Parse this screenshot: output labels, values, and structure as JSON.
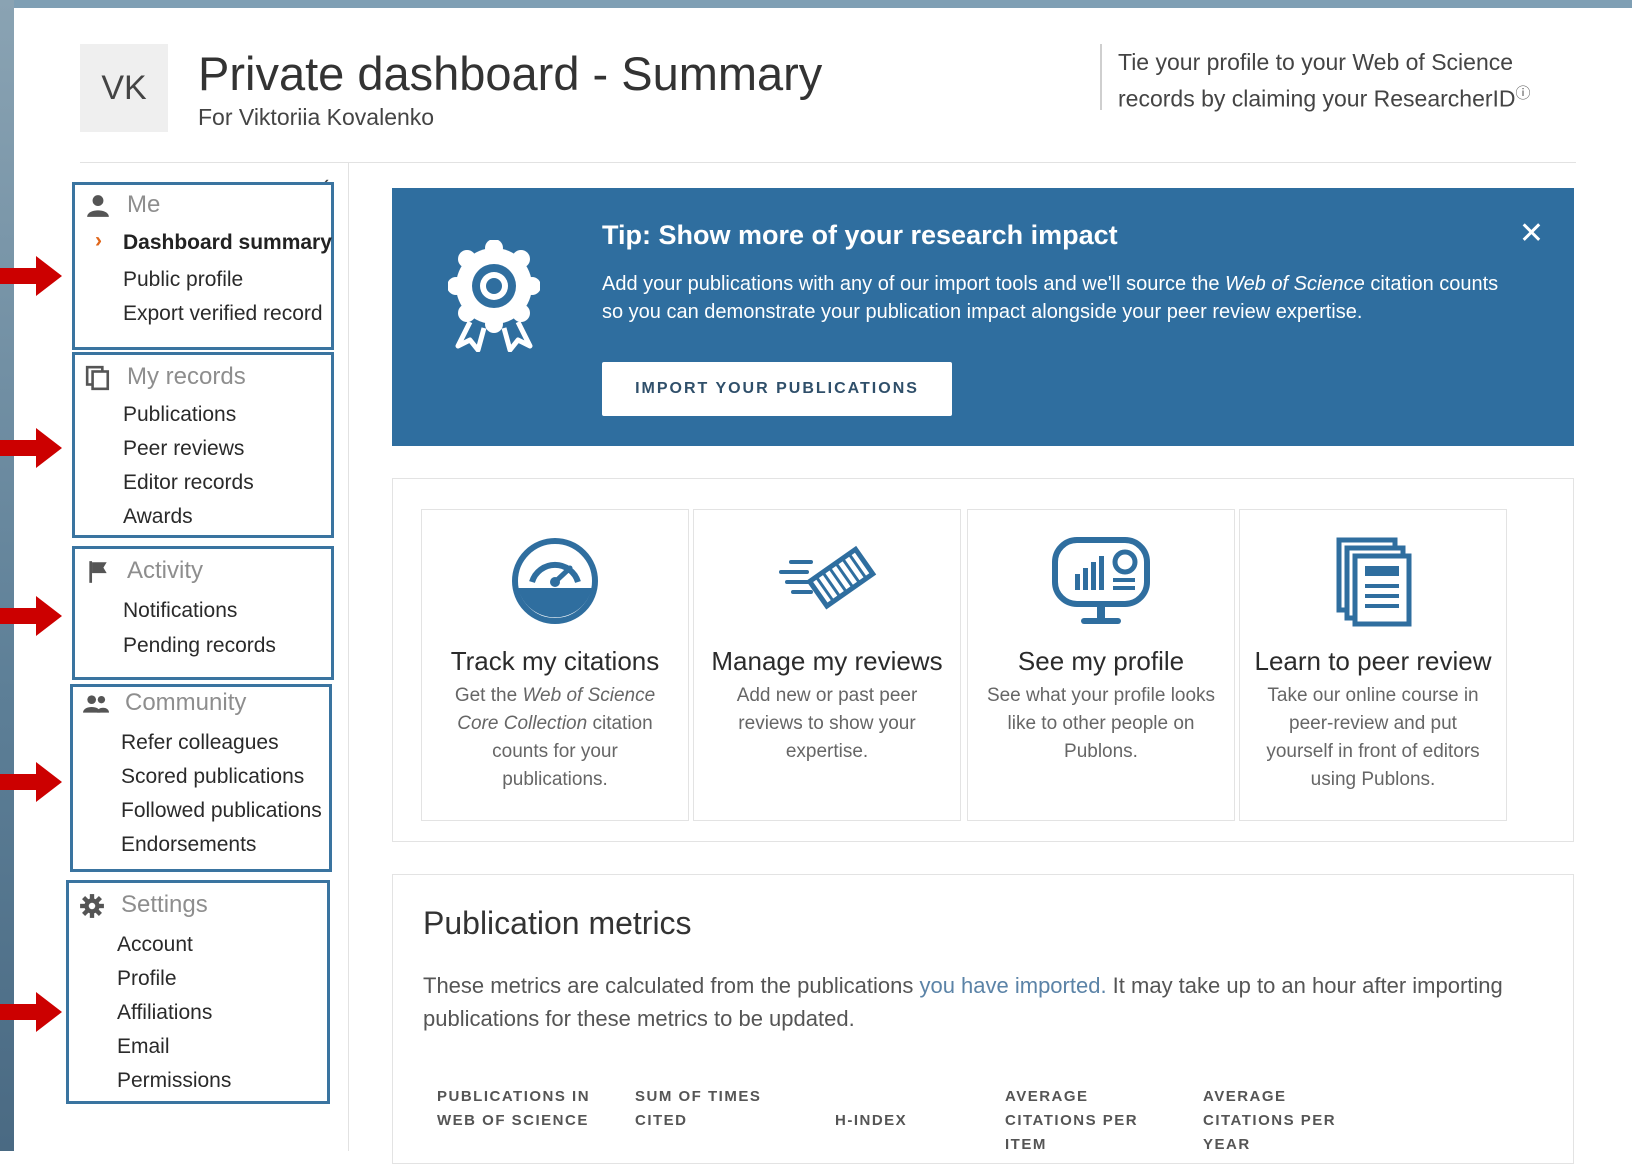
{
  "header": {
    "avatar_initials": "VK",
    "title": "Private dashboard - Summary",
    "subtitle": "For Viktoriia Kovalenko",
    "claim_text": "Tie your profile to your Web of Science records by claiming your ResearcherID",
    "help_icon": "?"
  },
  "sidebar": {
    "collapse_icon": "‹",
    "groups": [
      {
        "icon": "person-icon",
        "label": "Me",
        "items": [
          "Dashboard summary",
          "Public profile",
          "Export verified record"
        ],
        "active_item": "Dashboard summary"
      },
      {
        "icon": "records-icon",
        "label": "My records",
        "items": [
          "Publications",
          "Peer reviews",
          "Editor records",
          "Awards"
        ]
      },
      {
        "icon": "flag-icon",
        "label": "Activity",
        "items": [
          "Notifications",
          "Pending records"
        ]
      },
      {
        "icon": "community-icon",
        "label": "Community",
        "items": [
          "Refer colleagues",
          "Scored publications",
          "Followed publications",
          "Endorsements"
        ]
      },
      {
        "icon": "gear-icon",
        "label": "Settings",
        "items": [
          "Account",
          "Profile",
          "Affiliations",
          "Email",
          "Permissions"
        ]
      }
    ],
    "active_chevron": "›"
  },
  "tip": {
    "title": "Tip: Show more of your research impact",
    "body_before": "Add your publications with any of our import tools and we'll source the ",
    "body_em": "Web of Science",
    "body_after": " citation counts so you can demonstrate your publication impact alongside your peer review expertise.",
    "button": "IMPORT YOUR PUBLICATIONS",
    "close": "✕"
  },
  "cards": [
    {
      "icon": "gauge-icon",
      "title": "Track my citations",
      "desc_before": "Get the ",
      "desc_em": "Web of Science Core Collection",
      "desc_after": " citation counts for your publications."
    },
    {
      "icon": "review-icon",
      "title": "Manage my reviews",
      "desc_before": "Add new or past peer reviews to show your expertise.",
      "desc_em": "",
      "desc_after": ""
    },
    {
      "icon": "monitor-chart-icon",
      "title": "See my profile",
      "desc_before": "See what your profile looks like to other people on Publons.",
      "desc_em": "",
      "desc_after": ""
    },
    {
      "icon": "documents-icon",
      "title": "Learn to peer review",
      "desc_before": "Take our online course in peer-review and put yourself in front of editors using Publons.",
      "desc_em": "",
      "desc_after": ""
    }
  ],
  "metrics": {
    "title": "Publication metrics",
    "desc_before": "These metrics are calculated from the publications ",
    "desc_link": "you have imported.",
    "desc_after": "  It may take up to an hour after importing publications for these metrics to be updated.",
    "columns": [
      "PUBLICATIONS IN WEB OF SCIENCE",
      "SUM OF TIMES CITED",
      "H-INDEX",
      "AVERAGE CITATIONS PER ITEM",
      "AVERAGE CITATIONS PER YEAR"
    ]
  },
  "colors": {
    "accent": "#2f6e9f",
    "nav_border": "#3a74a0",
    "active_chevron": "#e0661a",
    "arrow": "#cc0000"
  }
}
